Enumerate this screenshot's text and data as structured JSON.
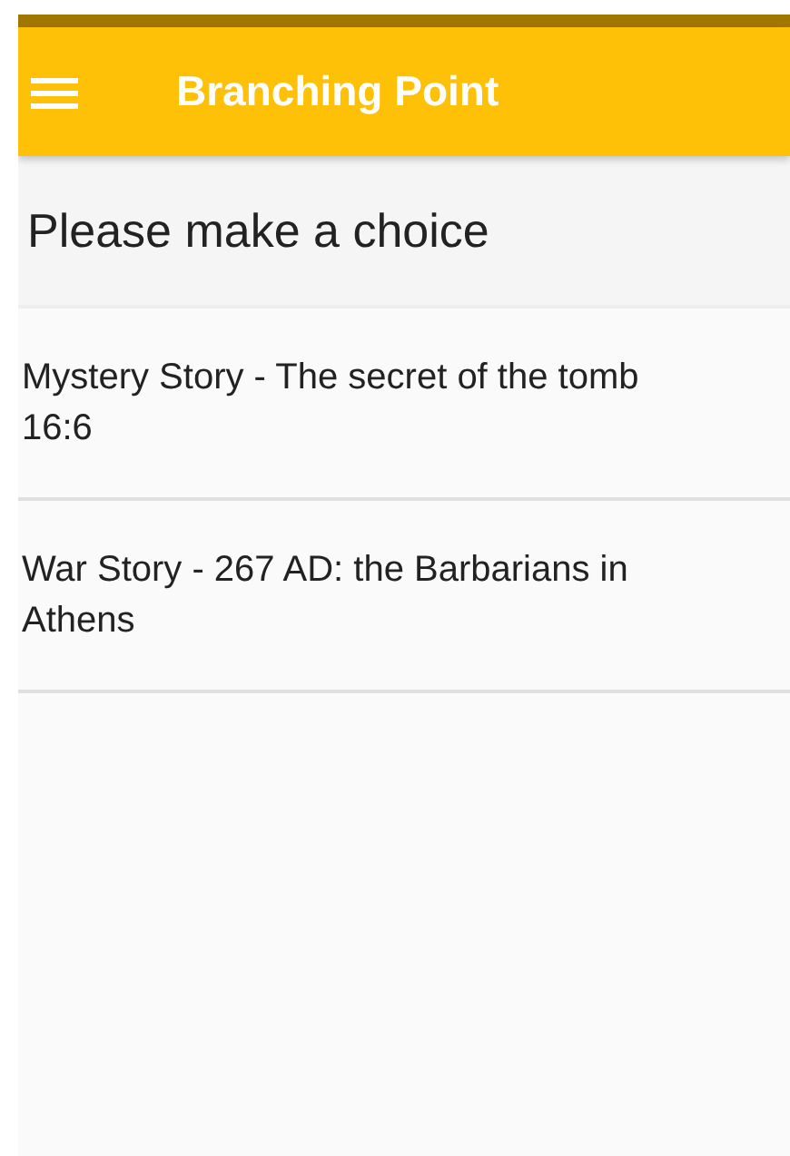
{
  "app_bar": {
    "title": "Branching Point"
  },
  "heading": "Please make a choice",
  "choices": [
    {
      "label": "Mystery Story - The secret of the tomb\n16:6"
    },
    {
      "label": "War Story - 267 AD: the Barbarians in\nAthens"
    }
  ]
}
